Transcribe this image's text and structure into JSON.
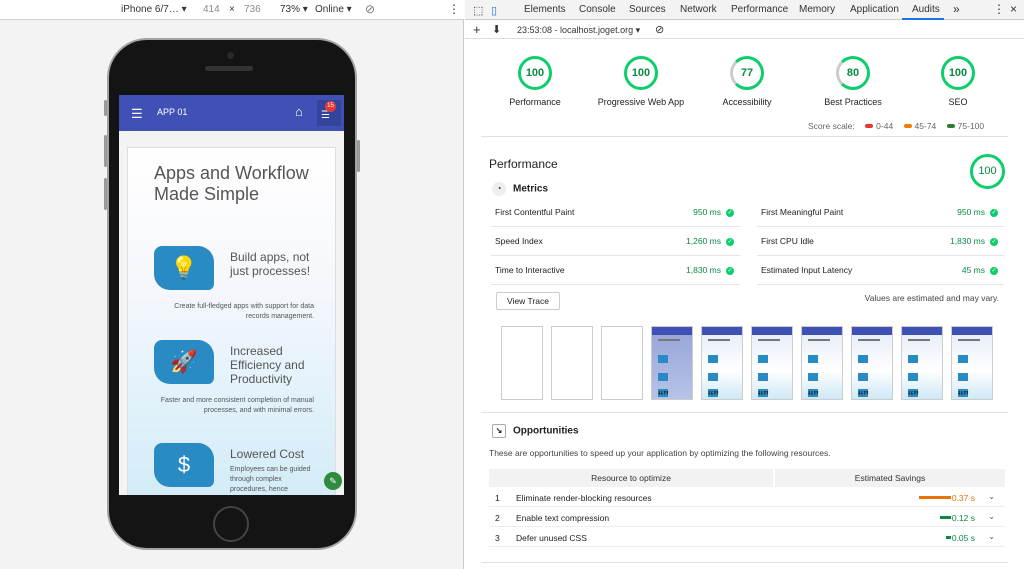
{
  "device_toolbar": {
    "device": "iPhone 6/7…",
    "width": "414",
    "times": "×",
    "height": "736",
    "zoom": "73%",
    "network": "Online"
  },
  "devtools": {
    "tabs": [
      "Elements",
      "Console",
      "Sources",
      "Network",
      "Performance",
      "Memory",
      "Application",
      "Audits"
    ],
    "active_tab": "Audits",
    "more": "»",
    "audit_time": "23:53:08 - localhost.joget.org"
  },
  "categories": [
    {
      "score": "100",
      "label": "Performance"
    },
    {
      "score": "100",
      "label": "Progressive Web App"
    },
    {
      "score": "77",
      "label": "Accessibility"
    },
    {
      "score": "80",
      "label": "Best Practices"
    },
    {
      "score": "100",
      "label": "SEO"
    }
  ],
  "scale": {
    "label": "Score scale:",
    "ranges": [
      "0-44",
      "45-74",
      "75-100"
    ],
    "colors": [
      "#e53935",
      "#f57c00",
      "#2e7d32"
    ]
  },
  "performance": {
    "title": "Performance",
    "score": "100",
    "metrics_title": "Metrics"
  },
  "metrics": [
    {
      "name": "First Contentful Paint",
      "value": "950 ms"
    },
    {
      "name": "First Meaningful Paint",
      "value": "950 ms"
    },
    {
      "name": "Speed Index",
      "value": "1,260 ms"
    },
    {
      "name": "First CPU Idle",
      "value": "1,830 ms"
    },
    {
      "name": "Time to Interactive",
      "value": "1,830 ms"
    },
    {
      "name": "Estimated Input Latency",
      "value": "45 ms"
    }
  ],
  "view_trace": "View Trace",
  "estimate_note": "Values are estimated and may vary.",
  "opportunities": {
    "title": "Opportunities",
    "description": "These are opportunities to speed up your application by optimizing the following resources.",
    "col_resource": "Resource to optimize",
    "col_savings": "Estimated Savings",
    "rows": [
      {
        "index": "1",
        "name": "Eliminate render-blocking resources",
        "savings": "0.37 s",
        "color": "#e8710a"
      },
      {
        "index": "2",
        "name": "Enable text compression",
        "savings": "0.12 s",
        "color": "#0a8a45"
      },
      {
        "index": "3",
        "name": "Defer unused CSS",
        "savings": "0.05 s",
        "color": "#0a8a45"
      }
    ]
  },
  "app": {
    "title": "APP 01",
    "badge": "15",
    "hero": "Apps and Workflow Made Simple",
    "features": [
      {
        "title": "Build apps, not just processes!",
        "desc": "Create full-fledged apps with support for data records management."
      },
      {
        "title": "Increased Efficiency and Productivity",
        "desc": "Faster and more consistent completion of manual processes, and with minimal errors."
      },
      {
        "title": "Lowered Cost",
        "desc": "Employees can be guided through complex procedures, hence"
      }
    ]
  }
}
